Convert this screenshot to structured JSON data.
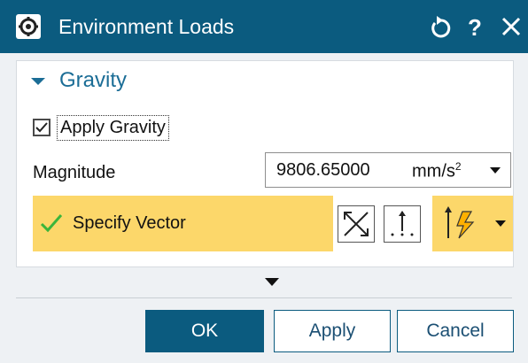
{
  "window": {
    "title": "Environment Loads",
    "icons": {
      "app": "gear-icon",
      "reset": "reset-icon",
      "help": "help-icon",
      "close": "close-icon"
    },
    "colors": {
      "titlebar": "#0b5b7f",
      "accent": "#fcd76a",
      "section": "#1b6d96"
    }
  },
  "gravity": {
    "section_title": "Gravity",
    "apply_gravity": {
      "label": "Apply Gravity",
      "checked": true
    },
    "magnitude": {
      "label": "Magnitude",
      "value": "9806.65000",
      "unit": "mm/s",
      "unit_sup": "2"
    },
    "specify_vector": {
      "label": "Specify Vector",
      "status": "complete"
    },
    "vector_tools": [
      "two-points-vector-icon",
      "inferred-vector-icon",
      "vector-options-icon"
    ]
  },
  "footer": {
    "ok_label": "OK",
    "apply_label": "Apply",
    "cancel_label": "Cancel"
  }
}
